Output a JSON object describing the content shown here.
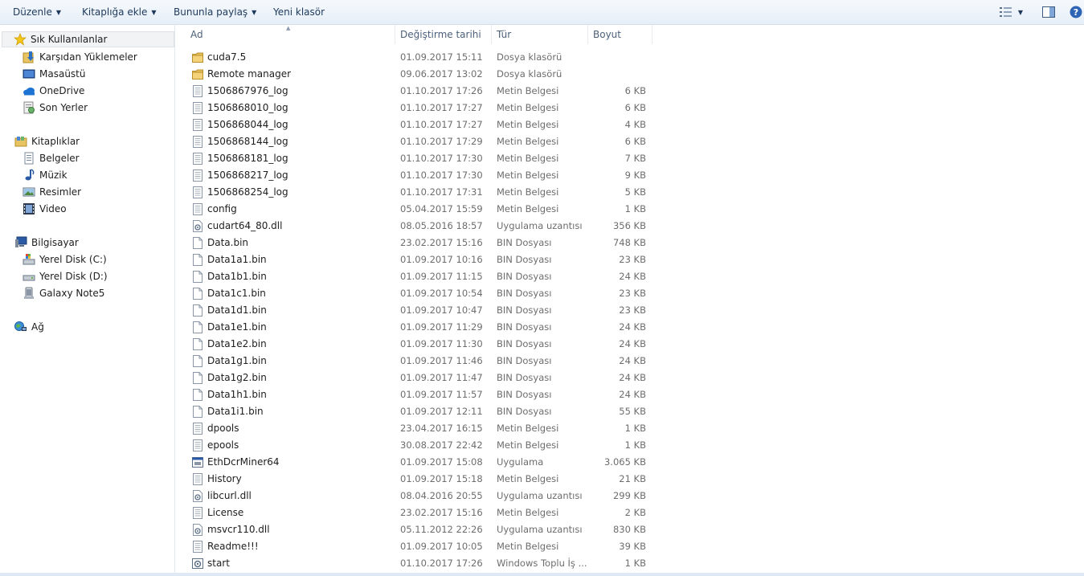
{
  "toolbar": {
    "organize": "Düzenle",
    "add_to_library": "Kitaplığa ekle",
    "share_with": "Bununla paylaş",
    "new_folder": "Yeni klasör"
  },
  "nav": {
    "favorites": {
      "label": "Sık Kullanılanlar",
      "items": [
        "Karşıdan Yüklemeler",
        "Masaüstü",
        "OneDrive",
        "Son Yerler"
      ]
    },
    "libraries": {
      "label": "Kitaplıklar",
      "items": [
        "Belgeler",
        "Müzik",
        "Resimler",
        "Video"
      ]
    },
    "computer": {
      "label": "Bilgisayar",
      "items": [
        "Yerel Disk (C:)",
        "Yerel Disk (D:)",
        "Galaxy Note5"
      ]
    },
    "network": {
      "label": "Ağ"
    }
  },
  "columns": {
    "name": "Ad",
    "date": "Değiştirme tarihi",
    "type": "Tür",
    "size": "Boyut"
  },
  "files": [
    {
      "name": "cuda7.5",
      "date": "01.09.2017 15:11",
      "type": "Dosya klasörü",
      "size": "",
      "icon": "folder-icon"
    },
    {
      "name": "Remote manager",
      "date": "09.06.2017 13:02",
      "type": "Dosya klasörü",
      "size": "",
      "icon": "folder-icon"
    },
    {
      "name": "1506867976_log",
      "date": "01.10.2017 17:26",
      "type": "Metin Belgesi",
      "size": "6 KB",
      "icon": "text-file-icon"
    },
    {
      "name": "1506868010_log",
      "date": "01.10.2017 17:27",
      "type": "Metin Belgesi",
      "size": "6 KB",
      "icon": "text-file-icon"
    },
    {
      "name": "1506868044_log",
      "date": "01.10.2017 17:27",
      "type": "Metin Belgesi",
      "size": "4 KB",
      "icon": "text-file-icon"
    },
    {
      "name": "1506868144_log",
      "date": "01.10.2017 17:29",
      "type": "Metin Belgesi",
      "size": "6 KB",
      "icon": "text-file-icon"
    },
    {
      "name": "1506868181_log",
      "date": "01.10.2017 17:30",
      "type": "Metin Belgesi",
      "size": "7 KB",
      "icon": "text-file-icon"
    },
    {
      "name": "1506868217_log",
      "date": "01.10.2017 17:30",
      "type": "Metin Belgesi",
      "size": "9 KB",
      "icon": "text-file-icon"
    },
    {
      "name": "1506868254_log",
      "date": "01.10.2017 17:31",
      "type": "Metin Belgesi",
      "size": "5 KB",
      "icon": "text-file-icon"
    },
    {
      "name": "config",
      "date": "05.04.2017 15:59",
      "type": "Metin Belgesi",
      "size": "1 KB",
      "icon": "text-file-icon"
    },
    {
      "name": "cudart64_80.dll",
      "date": "08.05.2016 18:57",
      "type": "Uygulama uzantısı",
      "size": "356 KB",
      "icon": "dll-file-icon"
    },
    {
      "name": "Data.bin",
      "date": "23.02.2017 15:16",
      "type": "BIN Dosyası",
      "size": "748 KB",
      "icon": "blank-file-icon"
    },
    {
      "name": "Data1a1.bin",
      "date": "01.09.2017 10:16",
      "type": "BIN Dosyası",
      "size": "23 KB",
      "icon": "blank-file-icon"
    },
    {
      "name": "Data1b1.bin",
      "date": "01.09.2017 11:15",
      "type": "BIN Dosyası",
      "size": "24 KB",
      "icon": "blank-file-icon"
    },
    {
      "name": "Data1c1.bin",
      "date": "01.09.2017 10:54",
      "type": "BIN Dosyası",
      "size": "23 KB",
      "icon": "blank-file-icon"
    },
    {
      "name": "Data1d1.bin",
      "date": "01.09.2017 10:47",
      "type": "BIN Dosyası",
      "size": "23 KB",
      "icon": "blank-file-icon"
    },
    {
      "name": "Data1e1.bin",
      "date": "01.09.2017 11:29",
      "type": "BIN Dosyası",
      "size": "24 KB",
      "icon": "blank-file-icon"
    },
    {
      "name": "Data1e2.bin",
      "date": "01.09.2017 11:30",
      "type": "BIN Dosyası",
      "size": "24 KB",
      "icon": "blank-file-icon"
    },
    {
      "name": "Data1g1.bin",
      "date": "01.09.2017 11:46",
      "type": "BIN Dosyası",
      "size": "24 KB",
      "icon": "blank-file-icon"
    },
    {
      "name": "Data1g2.bin",
      "date": "01.09.2017 11:47",
      "type": "BIN Dosyası",
      "size": "24 KB",
      "icon": "blank-file-icon"
    },
    {
      "name": "Data1h1.bin",
      "date": "01.09.2017 11:57",
      "type": "BIN Dosyası",
      "size": "24 KB",
      "icon": "blank-file-icon"
    },
    {
      "name": "Data1i1.bin",
      "date": "01.09.2017 12:11",
      "type": "BIN Dosyası",
      "size": "55 KB",
      "icon": "blank-file-icon"
    },
    {
      "name": "dpools",
      "date": "23.04.2017 16:15",
      "type": "Metin Belgesi",
      "size": "1 KB",
      "icon": "text-file-icon"
    },
    {
      "name": "epools",
      "date": "30.08.2017 22:42",
      "type": "Metin Belgesi",
      "size": "1 KB",
      "icon": "text-file-icon"
    },
    {
      "name": "EthDcrMiner64",
      "date": "01.09.2017 15:08",
      "type": "Uygulama",
      "size": "3.065 KB",
      "icon": "exe-file-icon"
    },
    {
      "name": "History",
      "date": "01.09.2017 15:18",
      "type": "Metin Belgesi",
      "size": "21 KB",
      "icon": "text-file-icon"
    },
    {
      "name": "libcurl.dll",
      "date": "08.04.2016 20:55",
      "type": "Uygulama uzantısı",
      "size": "299 KB",
      "icon": "dll-file-icon"
    },
    {
      "name": "License",
      "date": "23.02.2017 15:16",
      "type": "Metin Belgesi",
      "size": "2 KB",
      "icon": "text-file-icon"
    },
    {
      "name": "msvcr110.dll",
      "date": "05.11.2012 22:26",
      "type": "Uygulama uzantısı",
      "size": "830 KB",
      "icon": "dll-file-icon"
    },
    {
      "name": "Readme!!!",
      "date": "01.09.2017 10:05",
      "type": "Metin Belgesi",
      "size": "39 KB",
      "icon": "text-file-icon"
    },
    {
      "name": "start",
      "date": "01.10.2017 17:26",
      "type": "Windows Toplu İş ...",
      "size": "1 KB",
      "icon": "batch-file-icon"
    }
  ]
}
